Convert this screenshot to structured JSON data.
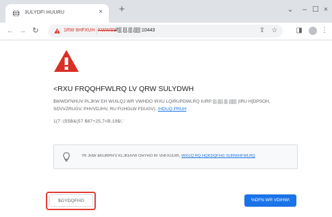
{
  "tab": {
    "title": "3ULYDF\\ HUURU",
    "close_glyph": "×",
    "newtab_glyph": "+"
  },
  "window": {
    "dropdown_glyph": "⌄",
    "minimize_glyph": "–",
    "maximize_glyph": "☐",
    "close_glyph": "×"
  },
  "nav": {
    "back_glyph": "←",
    "forward_glyph": "→",
    "reload_glyph": "↻"
  },
  "omnibox": {
    "security_label": "1RW 6HFXUH",
    "scheme": "KWWSV",
    "rest": "://[[[.[[[.[[[.[[[[[:10443",
    "share_glyph": "⇪",
    "star_glyph": "☆"
  },
  "toolbar": {
    "sidepanel_glyph": "◨",
    "menu_glyph": "⋮"
  },
  "interstitial": {
    "heading": "<RXU FRQQHFWLRQ LV QRW SULYDWH",
    "body": "$WWDFNHUV PLJKW EH WU\\LQJ WR VWHDO \\RXU LQIRUPDWLRQ IURP [[[.[[[[.[[[.[[[[[[ (IRU H[DPSOH, SDVVZRUGV, PHVVDJHV, RU FUHGLW FDUGV).",
    "learn_more": "/HDUQ PRUH",
    "error_code": "1(7::(55B&(57 $87+25,7<B,19$/,'",
    "info_text": "7R JHW &KURPH'V KLJKHVW OHYHO RI VHFXULW\\, ",
    "info_link": "WXUQ RQ HQKDQFHG SURWHFWLRQ",
    "advanced_label": "$GYDQFHG",
    "back_label": "%DFN WR VDIHW\\"
  },
  "colors": {
    "danger": "#d93025",
    "link": "#1a73e8",
    "highlight": "#e53935",
    "primary_button": "#1a73e8"
  },
  "icons": {
    "favicon": "globe-icon",
    "danger": "danger-triangle-icon",
    "info": "lightbulb-icon",
    "security": "warning-triangle-icon"
  }
}
